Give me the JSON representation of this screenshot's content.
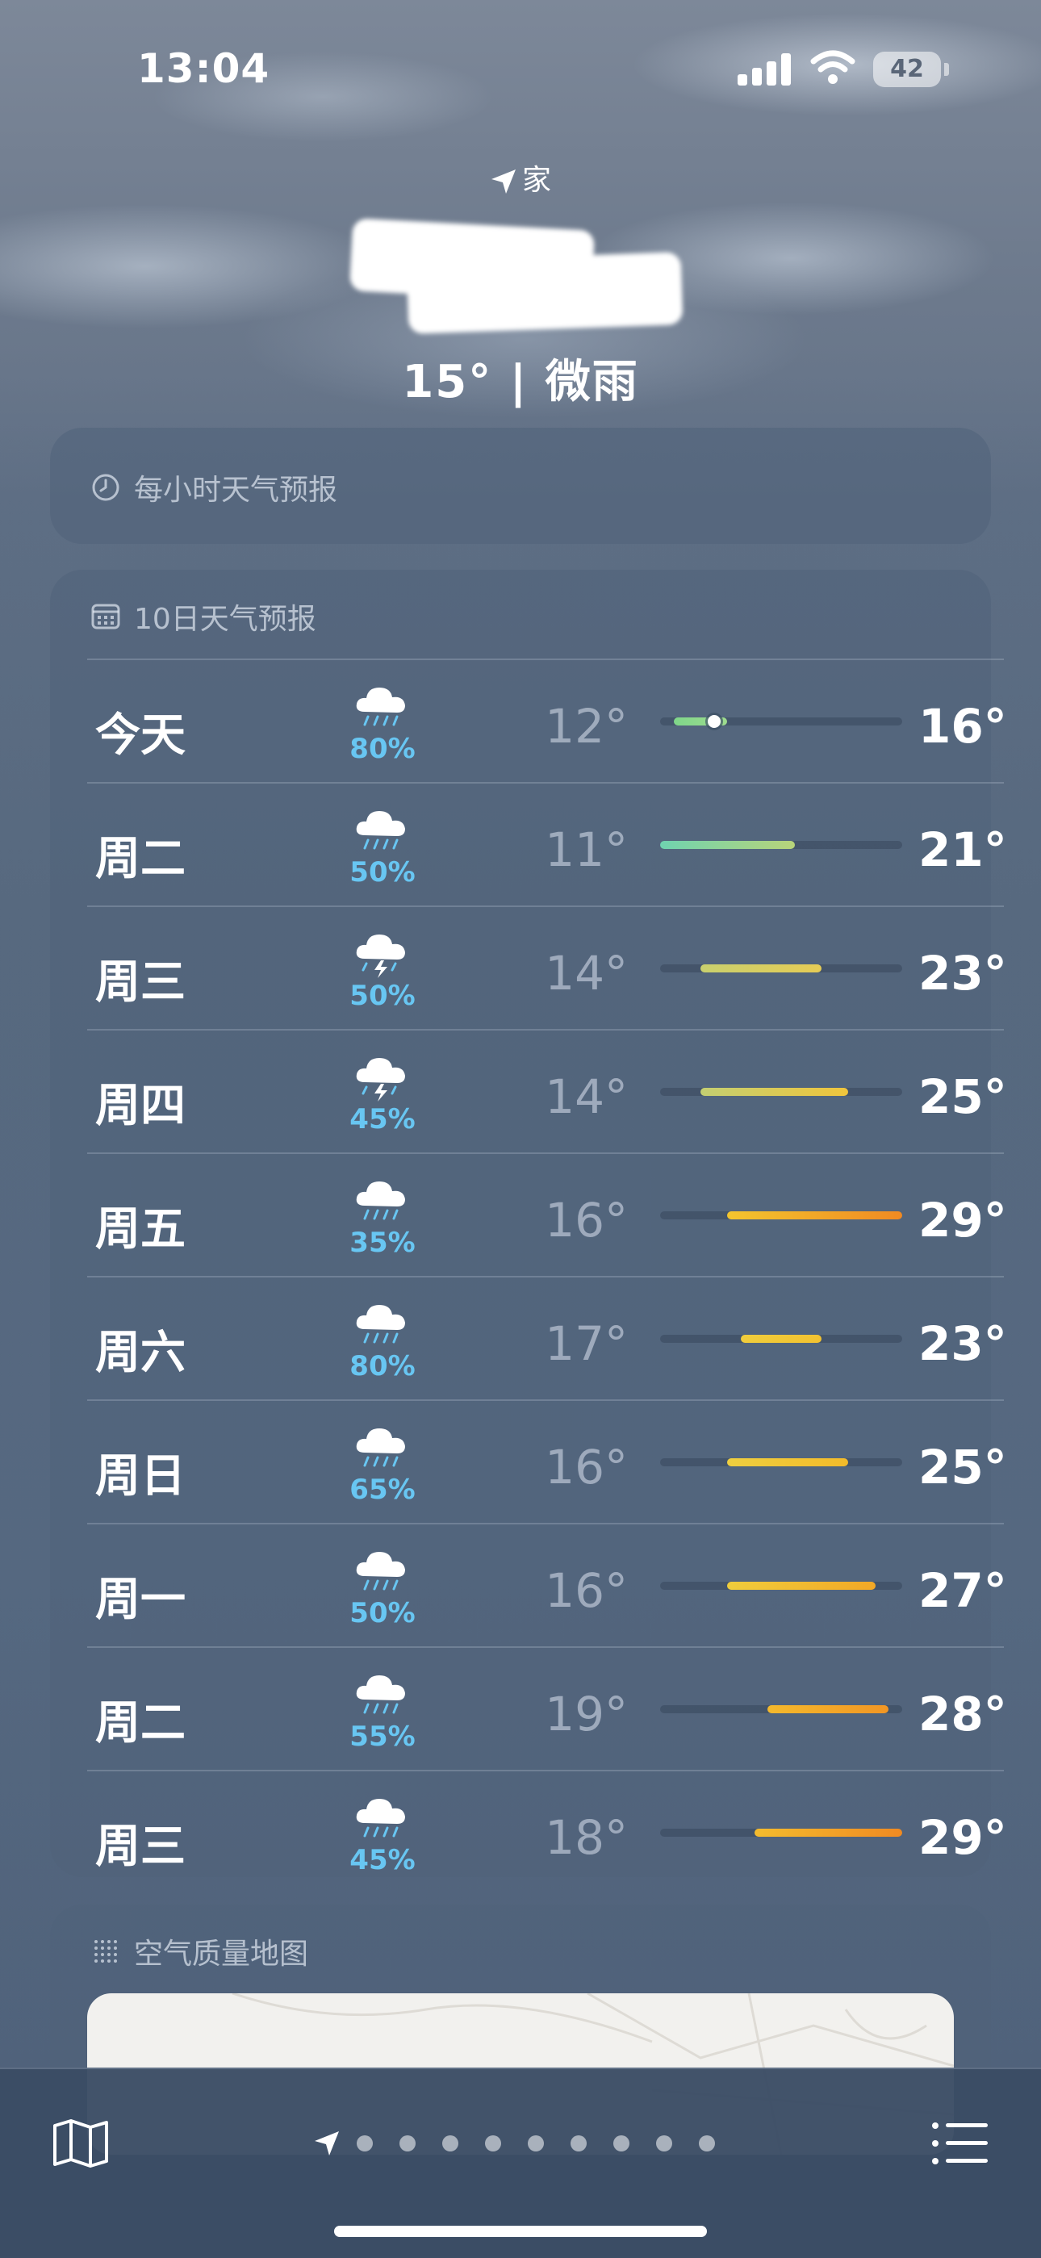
{
  "status_bar": {
    "time": "13:04",
    "battery": "42"
  },
  "header": {
    "location_label": "家",
    "current_conditions": "15° | 微雨"
  },
  "hourly_card": {
    "title": "每小时天气预报",
    "icon": "clock-icon"
  },
  "ten_day_card": {
    "title": "10日天气预报",
    "icon": "calendar-icon",
    "scale_min": 11,
    "scale_max": 29,
    "days": [
      {
        "day": "今天",
        "icon": "rain-cloud-icon",
        "precip": "80%",
        "low": "12°",
        "high": "16°",
        "low_value": 12,
        "high_value": 16,
        "current_value": 15,
        "bar_colors": [
          "#7fd68a",
          "#9fdc8e"
        ]
      },
      {
        "day": "周二",
        "icon": "rain-cloud-icon",
        "precip": "50%",
        "low": "11°",
        "high": "21°",
        "low_value": 11,
        "high_value": 21,
        "bar_colors": [
          "#6fd3b0",
          "#b8d47a"
        ]
      },
      {
        "day": "周三",
        "icon": "thunderstorm-cloud-icon",
        "precip": "50%",
        "low": "14°",
        "high": "23°",
        "low_value": 14,
        "high_value": 23,
        "bar_colors": [
          "#c9d06e",
          "#e6cc55"
        ]
      },
      {
        "day": "周四",
        "icon": "thunderstorm-cloud-icon",
        "precip": "45%",
        "low": "14°",
        "high": "25°",
        "low_value": 14,
        "high_value": 25,
        "bar_colors": [
          "#c4cf72",
          "#f0c53c"
        ]
      },
      {
        "day": "周五",
        "icon": "rain-cloud-icon",
        "precip": "35%",
        "low": "16°",
        "high": "29°",
        "low_value": 16,
        "high_value": 29,
        "bar_colors": [
          "#f3c52e",
          "#f08a22"
        ]
      },
      {
        "day": "周六",
        "icon": "rain-cloud-icon",
        "precip": "80%",
        "low": "17°",
        "high": "23°",
        "low_value": 17,
        "high_value": 23,
        "bar_colors": [
          "#f0cd3c",
          "#f2c230"
        ]
      },
      {
        "day": "周日",
        "icon": "rain-cloud-icon",
        "precip": "65%",
        "low": "16°",
        "high": "25°",
        "low_value": 16,
        "high_value": 25,
        "bar_colors": [
          "#efcf40",
          "#f3bb2a"
        ]
      },
      {
        "day": "周一",
        "icon": "rain-cloud-icon",
        "precip": "50%",
        "low": "16°",
        "high": "27°",
        "low_value": 16,
        "high_value": 27,
        "bar_colors": [
          "#efcd3c",
          "#f3a826"
        ]
      },
      {
        "day": "周二",
        "icon": "rain-cloud-icon",
        "precip": "55%",
        "low": "19°",
        "high": "28°",
        "low_value": 19,
        "high_value": 28,
        "bar_colors": [
          "#f4b92c",
          "#f29624"
        ]
      },
      {
        "day": "周三",
        "icon": "rain-cloud-icon",
        "precip": "45%",
        "low": "18°",
        "high": "29°",
        "low_value": 18,
        "high_value": 29,
        "bar_colors": [
          "#f4bc2e",
          "#f08a22"
        ]
      }
    ]
  },
  "air_quality_card": {
    "title": "空气质量地图",
    "icon": "air-quality-icon"
  },
  "tab_bar": {
    "map_icon": "map-icon",
    "location_icon": "location-arrow-icon",
    "page_count": 9,
    "list_icon": "list-icon"
  },
  "colors": {
    "precip": "#68c6f2",
    "card_bg": "rgba(80,98,122,0.55)"
  }
}
